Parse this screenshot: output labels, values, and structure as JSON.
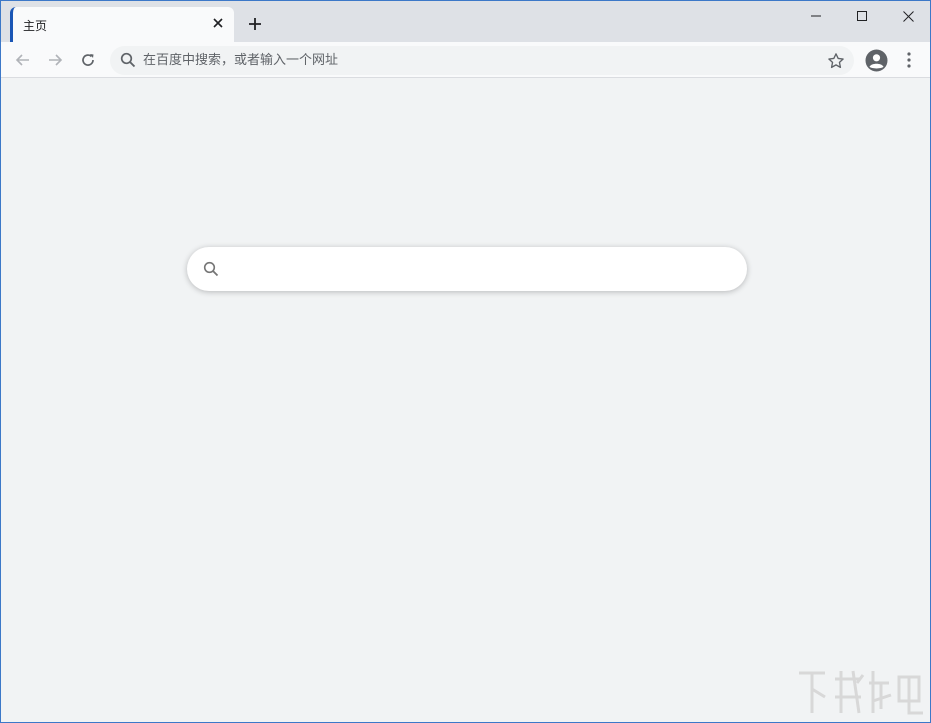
{
  "tab": {
    "title": "主页",
    "close_icon": "close-icon"
  },
  "window_controls": {
    "minimize_icon": "minimize-icon",
    "maximize_icon": "maximize-icon",
    "close_icon": "close-icon"
  },
  "toolbar": {
    "back_icon": "arrow-left-icon",
    "forward_icon": "arrow-right-icon",
    "reload_icon": "reload-icon",
    "omnibox": {
      "placeholder": "在百度中搜索，或者输入一个网址",
      "value": ""
    },
    "bookmark_icon": "star-icon",
    "profile_icon": "avatar-icon",
    "menu_icon": "more-vert-icon"
  },
  "main": {
    "search": {
      "placeholder": "",
      "value": ""
    }
  },
  "colors": {
    "tab_accent": "#1a56b5",
    "window_border": "#3c78c8",
    "page_background": "#f1f3f4"
  }
}
